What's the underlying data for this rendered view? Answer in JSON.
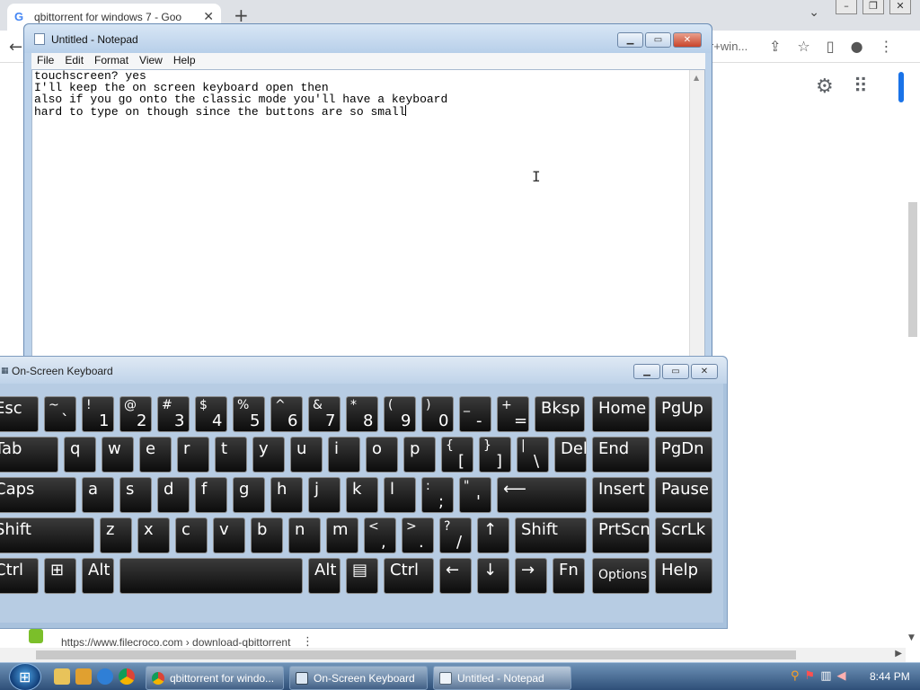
{
  "browser": {
    "tab_title": "qbittorrent for windows 7 - Goo",
    "omnibox_tail": "r+win...",
    "result_url": "https://www.filecroco.com › download-qbittorrent"
  },
  "notepad": {
    "title": "Untitled - Notepad",
    "menu": [
      "File",
      "Edit",
      "Format",
      "View",
      "Help"
    ],
    "lines": [
      "touchscreen? yes",
      "I'll keep the on screen keyboard open then",
      "",
      "also if you go onto the classic mode you'll have a keyboard",
      "hard to type on though since the buttons are so small"
    ]
  },
  "keyboard": {
    "title": "On-Screen Keyboard",
    "rows": [
      [
        {
          "m": "Esc"
        },
        {
          "t": "~",
          "b": "`"
        },
        {
          "t": "!",
          "b": "1"
        },
        {
          "t": "@",
          "b": "2"
        },
        {
          "t": "#",
          "b": "3"
        },
        {
          "t": "$",
          "b": "4"
        },
        {
          "t": "%",
          "b": "5"
        },
        {
          "t": "^",
          "b": "6"
        },
        {
          "t": "&",
          "b": "7"
        },
        {
          "t": "*",
          "b": "8"
        },
        {
          "t": "(",
          "b": "9"
        },
        {
          "t": ")",
          "b": "0"
        },
        {
          "t": "_",
          "b": "-"
        },
        {
          "t": "+",
          "b": "="
        },
        {
          "m": "Bksp"
        },
        {
          "m": "Home"
        },
        {
          "m": "PgUp"
        }
      ],
      [
        {
          "m": "Tab"
        },
        {
          "m": "q"
        },
        {
          "m": "w"
        },
        {
          "m": "e"
        },
        {
          "m": "r"
        },
        {
          "m": "t"
        },
        {
          "m": "y"
        },
        {
          "m": "u"
        },
        {
          "m": "i"
        },
        {
          "m": "o"
        },
        {
          "m": "p"
        },
        {
          "t": "{",
          "b": "["
        },
        {
          "t": "}",
          "b": "]"
        },
        {
          "t": "|",
          "b": "\\"
        },
        {
          "m": "Del"
        },
        {
          "m": "End"
        },
        {
          "m": "PgDn"
        }
      ],
      [
        {
          "m": "Caps"
        },
        {
          "m": "a"
        },
        {
          "m": "s"
        },
        {
          "m": "d"
        },
        {
          "m": "f"
        },
        {
          "m": "g"
        },
        {
          "m": "h"
        },
        {
          "m": "j"
        },
        {
          "m": "k"
        },
        {
          "m": "l"
        },
        {
          "t": ":",
          "b": ";"
        },
        {
          "t": "\"",
          "b": "'"
        },
        {
          "m": "⟵"
        },
        {
          "m": "Insert"
        },
        {
          "m": "Pause"
        }
      ],
      [
        {
          "m": "Shift"
        },
        {
          "m": "z"
        },
        {
          "m": "x"
        },
        {
          "m": "c"
        },
        {
          "m": "v"
        },
        {
          "m": "b"
        },
        {
          "m": "n"
        },
        {
          "m": "m"
        },
        {
          "t": "<",
          "b": ","
        },
        {
          "t": ">",
          "b": "."
        },
        {
          "t": "?",
          "b": "/"
        },
        {
          "m": "↑"
        },
        {
          "m": "Shift"
        },
        {
          "m": "PrtScn"
        },
        {
          "m": "ScrLk"
        }
      ],
      [
        {
          "m": "Ctrl"
        },
        {
          "m": "⊞"
        },
        {
          "m": "Alt"
        },
        {
          "m": ""
        },
        {
          "m": "Alt"
        },
        {
          "m": "▤"
        },
        {
          "m": "Ctrl"
        },
        {
          "m": "←"
        },
        {
          "m": "↓"
        },
        {
          "m": "→"
        },
        {
          "m": "Fn"
        },
        {
          "m": "Options",
          "small": true
        },
        {
          "m": "Help"
        }
      ]
    ]
  },
  "taskbar": {
    "buttons": [
      "qbittorrent for windo...",
      "On-Screen Keyboard",
      "Untitled - Notepad"
    ],
    "clock": "8:44 PM"
  }
}
